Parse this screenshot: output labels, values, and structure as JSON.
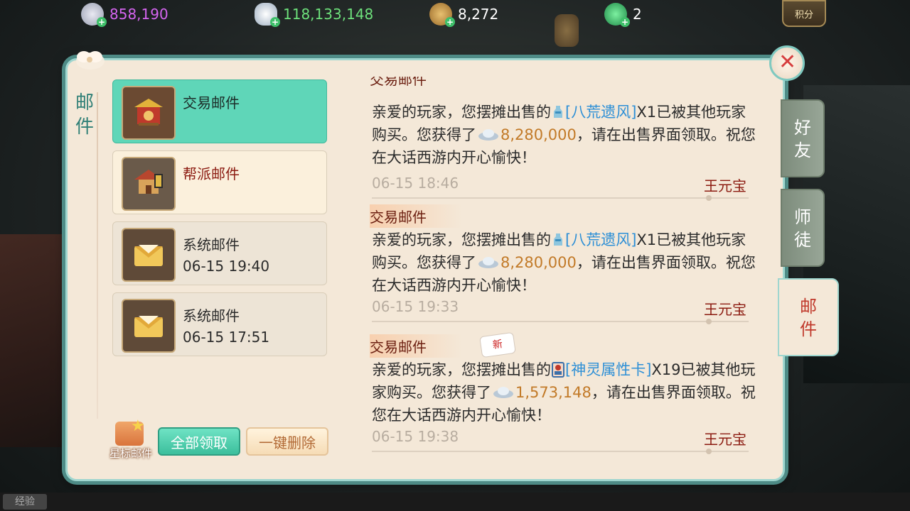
{
  "currencies": [
    {
      "name": "xianyu",
      "value": "858,190",
      "color": "#d565f0",
      "icon": "xianyu-coin-icon"
    },
    {
      "name": "silver",
      "value": "118,133,148",
      "color": "#6de07b",
      "icon": "silver-ingot-icon"
    },
    {
      "name": "copper",
      "value": "8,272",
      "color": "#ffffff",
      "icon": "copper-coin-icon"
    },
    {
      "name": "jade",
      "value": "2",
      "color": "#ffffff",
      "icon": "jade-icon"
    }
  ],
  "points_button": "积分",
  "panel_title": [
    "邮",
    "件"
  ],
  "mail_list": [
    {
      "name": "交易邮件",
      "time": "",
      "icon": "trade-mail-icon",
      "selected": true
    },
    {
      "name": "帮派邮件",
      "time": "",
      "icon": "clan-mail-icon",
      "selected": false
    },
    {
      "name": "系统邮件",
      "time": "06-15 19:40",
      "icon": "system-mail-icon",
      "selected": false
    },
    {
      "name": "系统邮件",
      "time": "06-15 17:51",
      "icon": "system-mail-icon",
      "selected": false
    }
  ],
  "star_mail_label": "星标邮件",
  "claim_all_label": "全部领取",
  "delete_all_label": "一键删除",
  "partial_header": "交易邮件",
  "messages": [
    {
      "header": "交易邮件",
      "p1": "亲爱的玩家，您摆摊出售的",
      "item": "[八荒遗风]",
      "p2": "X1已被其他玩家购买。您获得了",
      "amount": "8,280,000",
      "p3": "，请在出售界面领取。祝您在大话西游内开心愉快！",
      "date": "06-15 18:46",
      "sender": "王元宝",
      "is_new": false
    },
    {
      "header": "交易邮件",
      "p1": "亲爱的玩家，您摆摊出售的",
      "item": "[八荒遗风]",
      "p2": "X1已被其他玩家购买。您获得了",
      "amount": "8,280,000",
      "p3": "，请在出售界面领取。祝您在大话西游内开心愉快！",
      "date": "06-15 19:33",
      "sender": "王元宝",
      "is_new": false
    },
    {
      "header": "交易邮件",
      "p1": "亲爱的玩家，您摆摊出售的",
      "item": "[神灵属性卡]",
      "p2": "X19已被其他玩家购买。您获得了",
      "amount": "1,573,148",
      "p3": "，请在出售界面领取。祝您在大话西游内开心愉快！",
      "date": "06-15 19:38",
      "sender": "王元宝",
      "is_new": true,
      "new_label": "新"
    }
  ],
  "side_tabs": [
    {
      "label": [
        "好",
        "友"
      ],
      "active": false
    },
    {
      "label": [
        "师",
        "徒"
      ],
      "active": false
    },
    {
      "label": [
        "邮",
        "件"
      ],
      "active": true
    }
  ],
  "close_label": "✕",
  "bottom_left": "经验"
}
